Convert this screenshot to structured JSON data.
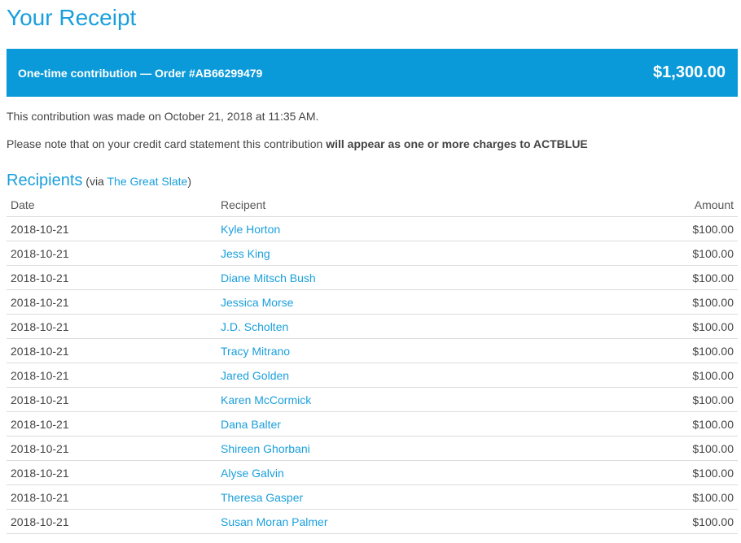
{
  "page": {
    "title": "Your Receipt"
  },
  "banner": {
    "order_text": "One-time contribution — Order #AB66299479",
    "amount": "$1,300.00"
  },
  "notes": {
    "made_on": "This contribution was made on October 21, 2018 at 11:35 AM.",
    "statement_prefix": "Please note that on your credit card statement this contribution ",
    "statement_bold": "will appear as one or more charges to ACTBLUE"
  },
  "recipients": {
    "heading": "Recipients",
    "via_prefix": "(via ",
    "via_link": "The Great Slate",
    "via_suffix": ")",
    "columns": {
      "date": "Date",
      "recipient": "Recipent",
      "amount": "Amount"
    },
    "rows": [
      {
        "date": "2018-10-21",
        "name": "Kyle Horton",
        "amount": "$100.00"
      },
      {
        "date": "2018-10-21",
        "name": "Jess King",
        "amount": "$100.00"
      },
      {
        "date": "2018-10-21",
        "name": "Diane Mitsch Bush",
        "amount": "$100.00"
      },
      {
        "date": "2018-10-21",
        "name": "Jessica Morse",
        "amount": "$100.00"
      },
      {
        "date": "2018-10-21",
        "name": "J.D. Scholten",
        "amount": "$100.00"
      },
      {
        "date": "2018-10-21",
        "name": "Tracy Mitrano",
        "amount": "$100.00"
      },
      {
        "date": "2018-10-21",
        "name": "Jared Golden",
        "amount": "$100.00"
      },
      {
        "date": "2018-10-21",
        "name": "Karen McCormick",
        "amount": "$100.00"
      },
      {
        "date": "2018-10-21",
        "name": "Dana Balter",
        "amount": "$100.00"
      },
      {
        "date": "2018-10-21",
        "name": "Shireen Ghorbani",
        "amount": "$100.00"
      },
      {
        "date": "2018-10-21",
        "name": "Alyse Galvin",
        "amount": "$100.00"
      },
      {
        "date": "2018-10-21",
        "name": "Theresa Gasper",
        "amount": "$100.00"
      },
      {
        "date": "2018-10-21",
        "name": "Susan Moran Palmer",
        "amount": "$100.00"
      }
    ]
  }
}
